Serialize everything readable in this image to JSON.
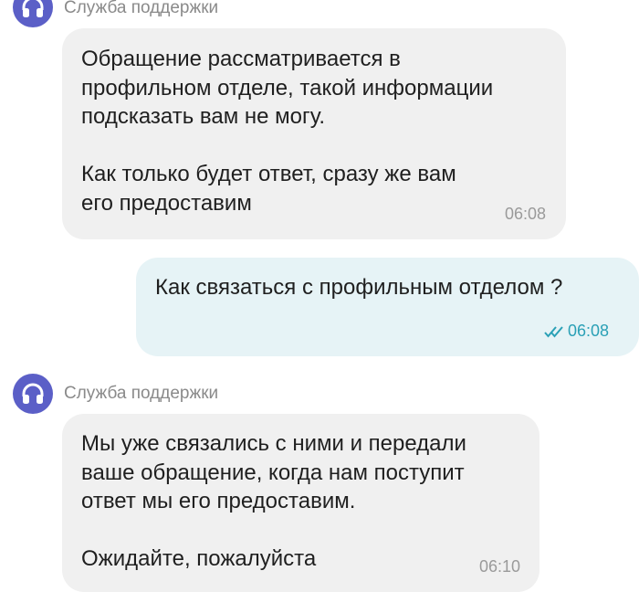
{
  "messages": [
    {
      "sender": "Служба поддержки",
      "text": "Обращение рассматривается в\nпрофильном отделе, такой информации\nподсказать вам не могу.\n\nКак только будет ответ, сразу же вам\nего предоставим",
      "time": "06:08"
    },
    {
      "text": "Как связаться с профильным отделом ?",
      "time": "06:08",
      "status": "read"
    },
    {
      "sender": "Служба поддержки",
      "text": "Мы уже связались с ними и передали\nваше обращение, когда нам поступит\nответ мы его предоставим.\n\nОжидайте, пожалуйста",
      "time": "06:10"
    }
  ],
  "icons": {
    "avatar": "headphones-icon",
    "read_status": "double-check-icon"
  },
  "colors": {
    "avatar_bg": "#5b5fc7",
    "incoming_bubble": "#f0f0f0",
    "outgoing_bubble": "#e6f3f6",
    "outgoing_time": "#2aa0b6"
  }
}
